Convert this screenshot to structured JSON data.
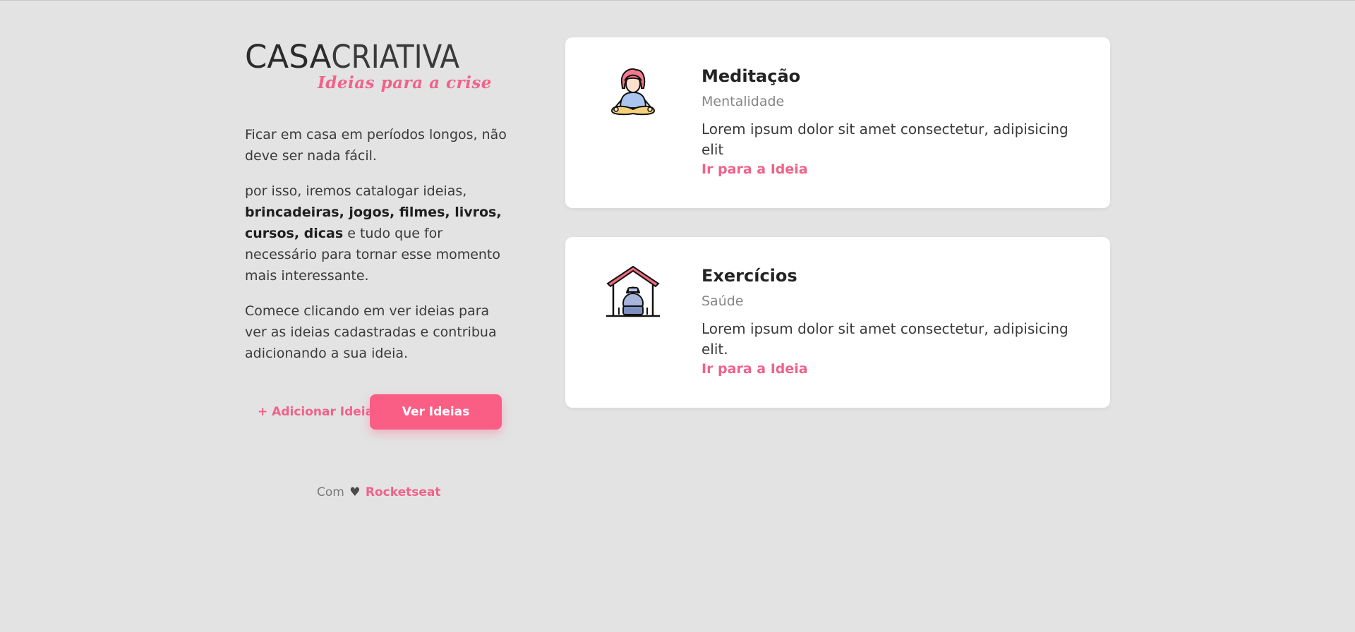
{
  "logo": {
    "brand_bold": "CASA",
    "brand_light": "CRIATIVA",
    "tagline": "Ideias para a crise"
  },
  "intro": {
    "p1": "Ficar em casa em períodos longos, não deve ser nada fácil.",
    "p2_start": "por isso, iremos catalogar ideias, ",
    "p2_bold": "brincadeiras, jogos, filmes, livros, cursos, dicas",
    "p2_end": " e tudo que for necessário para tornar esse momento mais interessante.",
    "p3": "Comece clicando em ver ideias para ver as ideias cadastradas e contribua adicionando a sua ideia."
  },
  "actions": {
    "add_label": "+ Adicionar Ideia",
    "see_label": "Ver Ideias"
  },
  "footer": {
    "prefix": "Com",
    "heart": "♥",
    "author": "Rocketseat"
  },
  "cards": [
    {
      "title": "Meditação",
      "category": "Mentalidade",
      "description": "Lorem ipsum dolor sit amet consectetur, adipisicing elit",
      "link": "Ir para a Ideia",
      "icon": "meditation-icon"
    },
    {
      "title": "Exercícios",
      "category": "Saúde",
      "description": "Lorem ipsum dolor sit amet consectetur, adipisicing elit.",
      "link": "Ir para a Ideia",
      "icon": "home-workout-icon"
    }
  ],
  "colors": {
    "accent": "#fa5e85",
    "background": "#e3e3e3",
    "card": "#ffffff"
  }
}
